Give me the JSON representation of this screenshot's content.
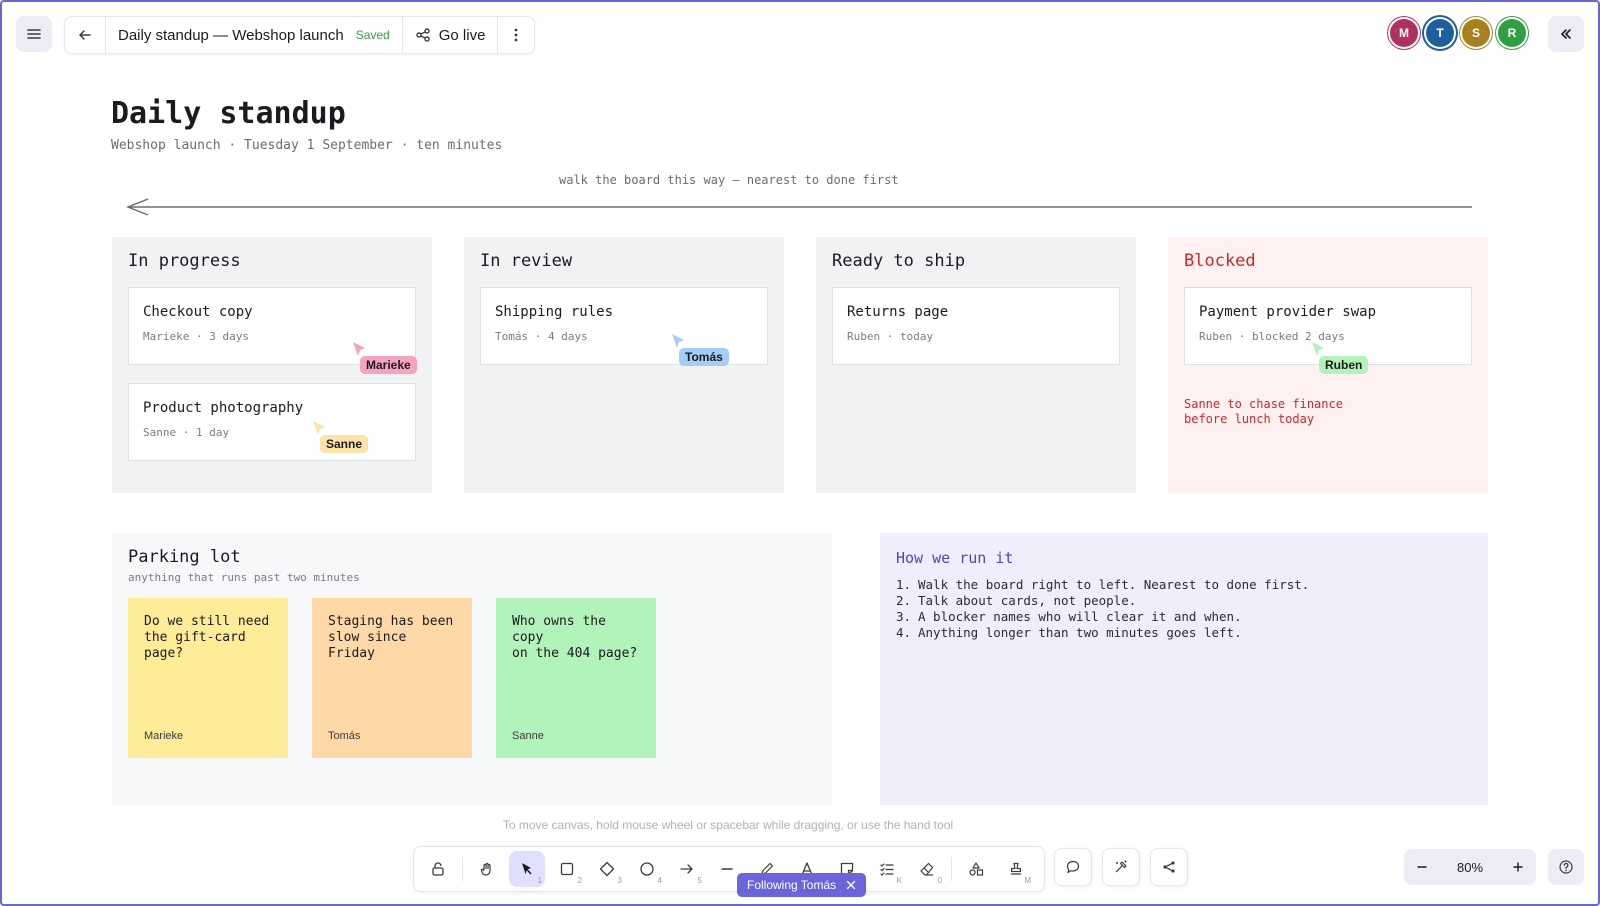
{
  "header": {
    "menu_icon": "hamburger-icon",
    "back_icon": "arrow-left-icon",
    "doc_title": "Daily standup — Webshop launch",
    "save_status": "Saved",
    "go_live_label": "Go live",
    "more_icon": "kebab-icon",
    "collapse_icon": "double-chevron-left-icon"
  },
  "collaborators": [
    {
      "initial": "M",
      "color": "#b03060"
    },
    {
      "initial": "T",
      "color": "#1f5f9e"
    },
    {
      "initial": "S",
      "color": "#a88020"
    },
    {
      "initial": "R",
      "color": "#2f9e44"
    }
  ],
  "board": {
    "title": "Daily standup",
    "subtitle": "Webshop launch · Tuesday 1 September · ten minutes",
    "direction_note": "walk the board this way — nearest to done first",
    "columns": [
      {
        "title": "In progress",
        "cards": [
          {
            "title": "Checkout copy",
            "meta": "Marieke · 3 days"
          },
          {
            "title": "Product photography",
            "meta": "Sanne · 1 day"
          }
        ]
      },
      {
        "title": "In review",
        "cards": [
          {
            "title": "Shipping rules",
            "meta": "Tomás · 4 days"
          }
        ]
      },
      {
        "title": "Ready to ship",
        "cards": [
          {
            "title": "Returns page",
            "meta": "Ruben · today"
          }
        ]
      },
      {
        "title": "Blocked",
        "cards": [
          {
            "title": "Payment provider swap",
            "meta": "Ruben · blocked 2 days"
          }
        ],
        "note_line1": "Sanne to chase finance",
        "note_line2": "before lunch today"
      }
    ],
    "cursors": [
      {
        "name": "Marieke",
        "color": "#f4a3c0"
      },
      {
        "name": "Tomás",
        "color": "#a5cdf5"
      },
      {
        "name": "Sanne",
        "color": "#fde3a7"
      },
      {
        "name": "Ruben",
        "color": "#b2f2bb"
      }
    ]
  },
  "parking_lot": {
    "title": "Parking lot",
    "subtitle": "anything that runs past two minutes",
    "notes": [
      {
        "line1": "Do we still need",
        "line2": "the gift-card page?",
        "author": "Marieke",
        "color": "#ffec99"
      },
      {
        "line1": "Staging has been",
        "line2": "slow since Friday",
        "author": "Tomás",
        "color": "#ffd8a8"
      },
      {
        "line1": "Who owns the copy",
        "line2": "on the 404 page?",
        "author": "Sanne",
        "color": "#b2f2bb"
      }
    ]
  },
  "how_we_run_it": {
    "title": "How we run it",
    "items": [
      {
        "num": "1.",
        "text": "Walk the board right to left. Nearest to done first."
      },
      {
        "num": "2.",
        "text": "Talk about cards, not people."
      },
      {
        "num": "3.",
        "text": "A blocker names who will clear it and when."
      },
      {
        "num": "4.",
        "text": "Anything longer than two minutes goes left."
      }
    ]
  },
  "canvas_hint": "To move canvas, hold mouse wheel or spacebar while dragging, or use the hand tool",
  "toolbar": {
    "tools": [
      {
        "name": "lock-icon",
        "key": ""
      },
      {
        "name": "hand-icon",
        "key": ""
      },
      {
        "name": "pointer-icon",
        "key": "1"
      },
      {
        "name": "rectangle-icon",
        "key": "2"
      },
      {
        "name": "diamond-icon",
        "key": "3"
      },
      {
        "name": "ellipse-icon",
        "key": "4"
      },
      {
        "name": "arrow-icon",
        "key": "5"
      },
      {
        "name": "line-icon",
        "key": ""
      },
      {
        "name": "pencil-icon",
        "key": ""
      },
      {
        "name": "text-icon",
        "key": ""
      },
      {
        "name": "sticky-note-icon",
        "key": ""
      },
      {
        "name": "checklist-icon",
        "key": "K"
      },
      {
        "name": "eraser-icon",
        "key": "0"
      },
      {
        "name": "shapes-library-icon",
        "key": ""
      },
      {
        "name": "stamp-icon",
        "key": "M"
      }
    ],
    "following_label": "Following Tomás"
  },
  "zoom": {
    "value": "80%"
  }
}
